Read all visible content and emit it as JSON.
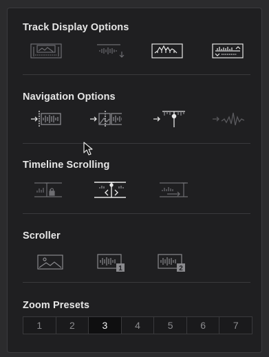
{
  "sections": {
    "track_display": {
      "title": "Track Display Options"
    },
    "navigation": {
      "title": "Navigation Options"
    },
    "timeline_scrolling": {
      "title": "Timeline Scrolling"
    },
    "scroller": {
      "title": "Scroller"
    },
    "zoom_presets": {
      "title": "Zoom Presets"
    }
  },
  "scroller_badges": {
    "one": "1",
    "two": "2"
  },
  "zoom_presets": {
    "items": [
      "1",
      "2",
      "3",
      "4",
      "5",
      "6",
      "7"
    ],
    "active": "3"
  },
  "colors": {
    "panel_bg": "#1f1f21",
    "icon_dim": "#6e6e72",
    "icon_bright": "#e8e8e8",
    "text": "#e6e6e6"
  },
  "icons": [
    "filmstrip-waveform-icon",
    "waveform-arrow-down-icon",
    "waveform-peaks-icon",
    "waveform-stacked-icon",
    "arrow-playhead-waveform-icon",
    "arrow-thumbnail-waveform-icon",
    "arrow-playhead-marker-icon",
    "arrow-waveform-peak-icon",
    "playhead-lock-icon",
    "playhead-center-scroll-icon",
    "playhead-page-scroll-icon",
    "image-thumbnail-icon",
    "waveform-badge-1-icon",
    "waveform-badge-2-icon"
  ]
}
